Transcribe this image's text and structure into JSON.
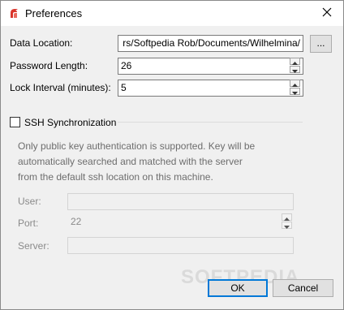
{
  "window": {
    "title": "Preferences",
    "watermark": "SOFTPEDIA"
  },
  "form": {
    "data_location": {
      "label": "Data Location:",
      "value": "rs/Softpedia Rob/Documents/Wilhelmina/",
      "browse_label": "..."
    },
    "password_length": {
      "label": "Password Length:",
      "value": "26"
    },
    "lock_interval": {
      "label": "Lock Interval (minutes):",
      "value": "5"
    }
  },
  "ssh": {
    "checkbox_label": "SSH Synchronization",
    "checked": false,
    "description": [
      "Only public key authentication is supported. Key will be",
      "automatically searched and matched with the server",
      "from the default ssh location on this machine."
    ],
    "user": {
      "label": "User:",
      "value": ""
    },
    "port": {
      "label": "Port:",
      "value": "22"
    },
    "server": {
      "label": "Server:",
      "value": ""
    }
  },
  "buttons": {
    "ok": "OK",
    "cancel": "Cancel"
  },
  "colors": {
    "accent": "#0078d7",
    "app_icon": "#d9342b"
  }
}
